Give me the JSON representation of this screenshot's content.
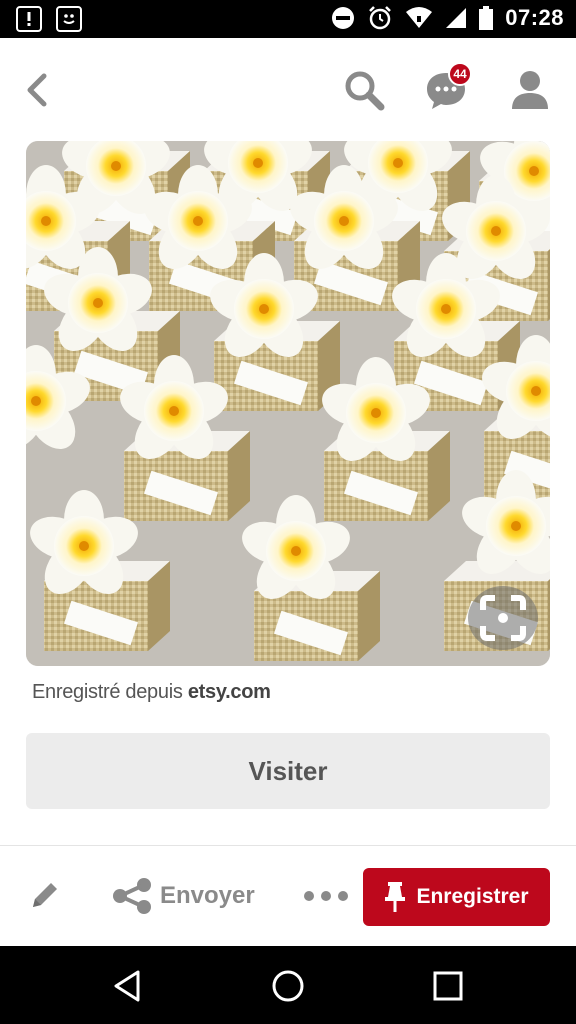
{
  "status_bar": {
    "time": "07:28",
    "icons": [
      "alert-box-icon",
      "smiley-box-icon",
      "dnd-icon",
      "alarm-icon",
      "wifi-icon",
      "signal-icon",
      "battery-icon"
    ]
  },
  "header": {
    "icons": [
      "back-arrow-icon",
      "search-icon",
      "chat-icon",
      "profile-icon"
    ],
    "notification_count": "44"
  },
  "pin": {
    "image_subject": "frangipani-favor-boxes",
    "source_prefix": "Enregistré depuis ",
    "source_domain": "etsy.com",
    "visit_label": "Visiter"
  },
  "actions": {
    "send_label": "Envoyer",
    "save_label": "Enregistrer"
  },
  "nav": {
    "icons": [
      "nav-back-icon",
      "nav-home-icon",
      "nav-recents-icon"
    ]
  },
  "colors": {
    "accent": "#bd081c",
    "visit_bg": "#ececec",
    "icon_gray": "#8a8a8a"
  }
}
